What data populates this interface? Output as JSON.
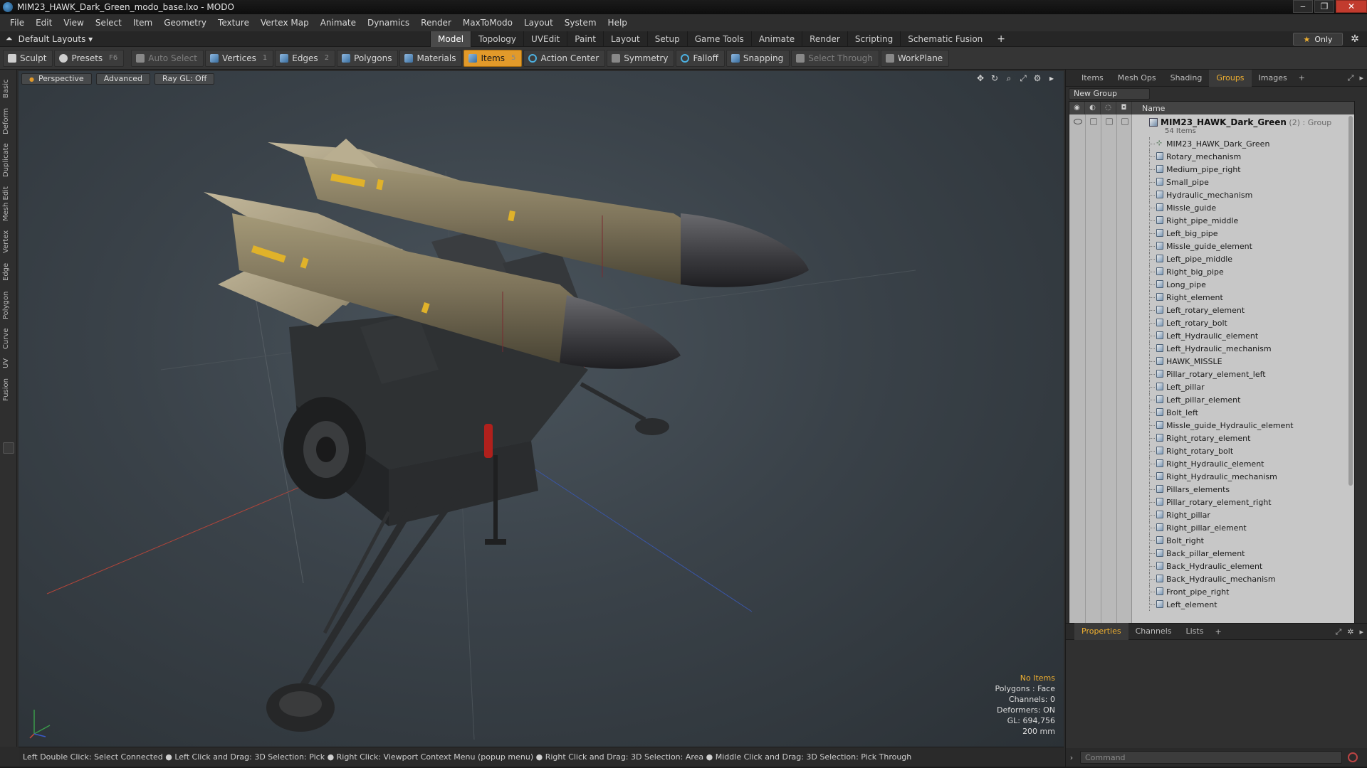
{
  "window": {
    "title": "MIM23_HAWK_Dark_Green_modo_base.lxo - MODO",
    "controls": [
      "‒",
      "❐",
      "✕"
    ]
  },
  "menu": [
    "File",
    "Edit",
    "View",
    "Select",
    "Item",
    "Geometry",
    "Texture",
    "Vertex Map",
    "Animate",
    "Dynamics",
    "Render",
    "MaxToModo",
    "Layout",
    "System",
    "Help"
  ],
  "layout": {
    "selector": "Default Layouts ▾",
    "tabs": [
      "Model",
      "Topology",
      "UVEdit",
      "Paint",
      "Layout",
      "Setup",
      "Game Tools",
      "Animate",
      "Render",
      "Scripting",
      "Schematic Fusion"
    ],
    "active_tab": "Model",
    "add_label": "+",
    "only_label": "Only",
    "gear": "✲"
  },
  "toolbar": {
    "sculpt": "Sculpt",
    "presets": "Presets",
    "presets_key": "F6",
    "auto_select": "Auto Select",
    "vertices": "Vertices",
    "vertices_key": "1",
    "edges": "Edges",
    "edges_key": "2",
    "polygons": "Polygons",
    "materials": "Materials",
    "items": "Items",
    "items_key": "5",
    "action_center": "Action Center",
    "symmetry": "Symmetry",
    "falloff": "Falloff",
    "snapping": "Snapping",
    "select_through": "Select Through",
    "workplane": "WorkPlane"
  },
  "left_tabs": [
    "Basic",
    "Deform",
    "Duplicate",
    "Mesh Edit",
    "Vertex",
    "Edge",
    "Polygon",
    "Curve",
    "UV",
    "Fusion"
  ],
  "viewport": {
    "view_label": "Perspective",
    "shading_label": "Advanced",
    "raygl_label": "Ray GL: Off",
    "icons": [
      "✥",
      "↻",
      "⌕",
      "⤢",
      "⚙",
      "▸"
    ],
    "stats": {
      "items": "No Items",
      "polygons": "Polygons : Face",
      "channels": "Channels: 0",
      "deformers": "Deformers: ON",
      "gl": "GL: 694,756",
      "scale": "200 mm"
    }
  },
  "status_bar": "Left Double Click: Select Connected ● Left Click and Drag: 3D Selection: Pick ● Right Click: Viewport Context Menu (popup menu) ● Right Click and Drag: 3D Selection: Area ● Middle Click and Drag: 3D Selection: Pick Through",
  "right_panel": {
    "tabs": [
      "Items",
      "Mesh Ops",
      "Shading",
      "Groups",
      "Images"
    ],
    "active_tab": "Groups",
    "add_label": "+",
    "new_group": "New Group",
    "column_name": "Name",
    "group": {
      "name": "MIM23_HAWK_Dark_Green",
      "meta": " (2) : Group",
      "count": "54 Items"
    },
    "items": [
      "MIM23_HAWK_Dark_Green",
      "Rotary_mechanism",
      "Medium_pipe_right",
      "Small_pipe",
      "Hydraulic_mechanism",
      "Missle_guide",
      "Right_pipe_middle",
      "Left_big_pipe",
      "Missle_guide_element",
      "Left_pipe_middle",
      "Right_big_pipe",
      "Long_pipe",
      "Right_element",
      "Left_rotary_element",
      "Left_rotary_bolt",
      "Left_Hydraulic_element",
      "Left_Hydraulic_mechanism",
      "HAWK_MISSLE",
      "Pillar_rotary_element_left",
      "Left_pillar",
      "Left_pillar_element",
      "Bolt_left",
      "Missle_guide_Hydraulic_element",
      "Right_rotary_element",
      "Right_rotary_bolt",
      "Right_Hydraulic_element",
      "Right_Hydraulic_mechanism",
      "Pillars_elements",
      "Pillar_rotary_element_right",
      "Right_pillar",
      "Right_pillar_element",
      "Bolt_right",
      "Back_pillar_element",
      "Back_Hydraulic_element",
      "Back_Hydraulic_mechanism",
      "Front_pipe_right",
      "Left_element"
    ],
    "prop_tabs": [
      "Properties",
      "Channels",
      "Lists"
    ],
    "prop_active": "Properties",
    "command_placeholder": "Command"
  },
  "colors": {
    "accent": "#e29a2a",
    "viewport_bg": "#3a4249",
    "list_bg": "#c7c7c7"
  }
}
